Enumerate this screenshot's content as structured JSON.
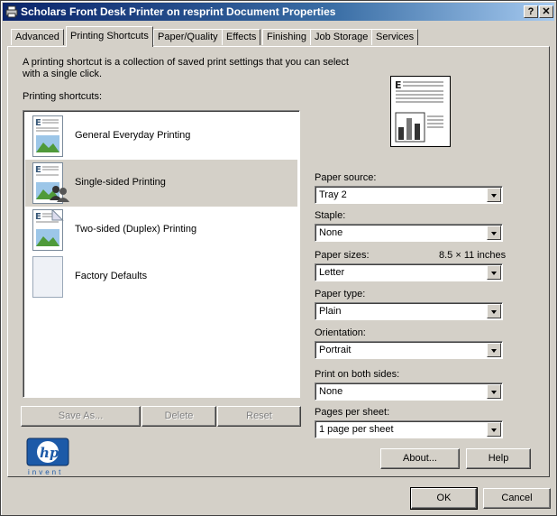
{
  "window": {
    "title": "Scholars Front Desk Printer on resprint Document Properties",
    "help_btn": "?",
    "close_btn": "✕"
  },
  "tabs": [
    {
      "label": "Advanced",
      "active": false
    },
    {
      "label": "Printing Shortcuts",
      "active": true
    },
    {
      "label": "Paper/Quality",
      "active": false
    },
    {
      "label": "Effects",
      "active": false
    },
    {
      "label": "Finishing",
      "active": false
    },
    {
      "label": "Job Storage",
      "active": false
    },
    {
      "label": "Services",
      "active": false
    }
  ],
  "panel": {
    "description": "A printing shortcut is a collection of saved print settings that you can select with a single click.",
    "shortcuts_label": "Printing shortcuts:",
    "shortcuts": [
      {
        "label": "General Everyday Printing",
        "selected": false,
        "icon": "document-landscape-icon"
      },
      {
        "label": "Single-sided Printing",
        "selected": true,
        "icon": "document-users-icon"
      },
      {
        "label": "Two-sided (Duplex) Printing",
        "selected": false,
        "icon": "document-duplex-icon"
      },
      {
        "label": "Factory Defaults",
        "selected": false,
        "icon": "blank-document-icon"
      }
    ],
    "save_as": "Save As...",
    "delete": "Delete",
    "reset": "Reset"
  },
  "settings": {
    "paper_source": {
      "label": "Paper source:",
      "value": "Tray 2"
    },
    "staple": {
      "label": "Staple:",
      "value": "None"
    },
    "paper_sizes": {
      "label": "Paper sizes:",
      "value": "Letter",
      "dimension": "8.5 × 11 inches"
    },
    "paper_type": {
      "label": "Paper type:",
      "value": "Plain"
    },
    "orientation": {
      "label": "Orientation:",
      "value": "Portrait"
    },
    "print_both_sides": {
      "label": "Print on both sides:",
      "value": "None"
    },
    "pages_per_sheet": {
      "label": "Pages per sheet:",
      "value": "1 page per sheet"
    }
  },
  "logo": {
    "text": "invent"
  },
  "buttons": {
    "about": "About...",
    "help": "Help",
    "ok": "OK",
    "cancel": "Cancel"
  }
}
